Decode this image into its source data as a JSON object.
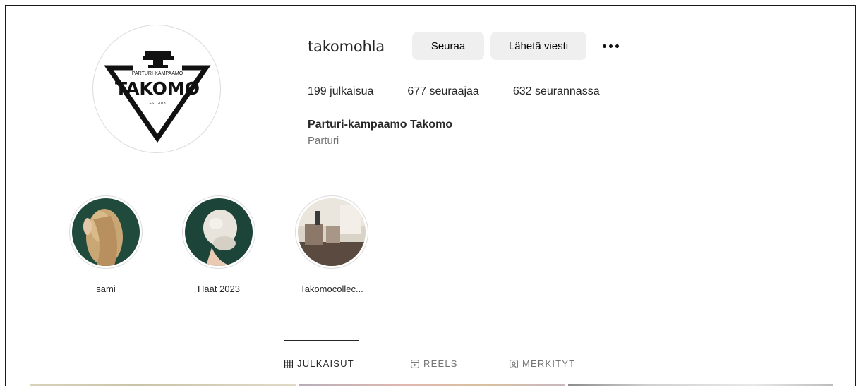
{
  "profile": {
    "username": "takomohla",
    "follow_label": "Seuraa",
    "message_label": "Lähetä viesti",
    "stats": {
      "posts": "199 julkaisua",
      "followers": "677 seuraajaa",
      "following": "632 seurannassa"
    },
    "full_name": "Parturi-kampaamo Takomo",
    "category": "Parturi"
  },
  "logo": {
    "top_text": "PARTURI-KAMPAAMO",
    "main_text": "TAKOMO",
    "est_text": "EST. 2018"
  },
  "highlights": [
    {
      "label": "sami"
    },
    {
      "label": "Häät 2023"
    },
    {
      "label": "Takomocollec..."
    }
  ],
  "tabs": [
    {
      "label": "JULKAISUT",
      "icon": "grid-icon",
      "active": true
    },
    {
      "label": "REELS",
      "icon": "reels-icon",
      "active": false
    },
    {
      "label": "MERKITYT",
      "icon": "tagged-icon",
      "active": false
    }
  ],
  "colors": {
    "button_bg": "#efefef",
    "secondary_text": "#737373",
    "divider": "#dbdbdb"
  }
}
